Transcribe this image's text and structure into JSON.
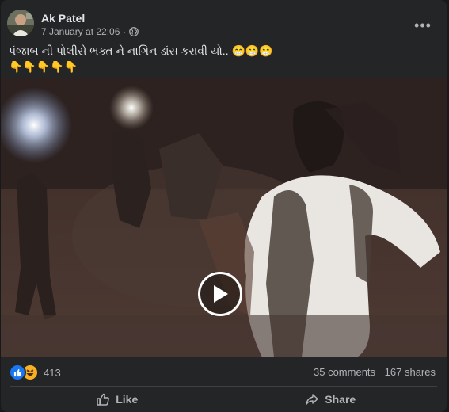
{
  "post": {
    "author": "Ak Patel",
    "timestamp": "7 January at 22:06",
    "separator": "·",
    "privacy_icon": "globe-icon",
    "more_label": "•••",
    "caption_line1": "પંજાબ ની પોલીસે ભક્ત ને નાગિન ડાંસ કરાવી યો.. 😁😁😁",
    "caption_line2": "👇👇👇👇👇"
  },
  "video": {
    "play_icon": "play-icon"
  },
  "engagement": {
    "reaction_icons": [
      "like-icon",
      "haha-icon"
    ],
    "reaction_count": "413",
    "comments": "35 comments",
    "shares": "167 shares"
  },
  "actions": {
    "like_label": "Like",
    "share_label": "Share"
  },
  "colors": {
    "card": "#242526",
    "background": "#18191a",
    "like_blue": "#1877f2",
    "haha_yellow": "#f7b125"
  }
}
